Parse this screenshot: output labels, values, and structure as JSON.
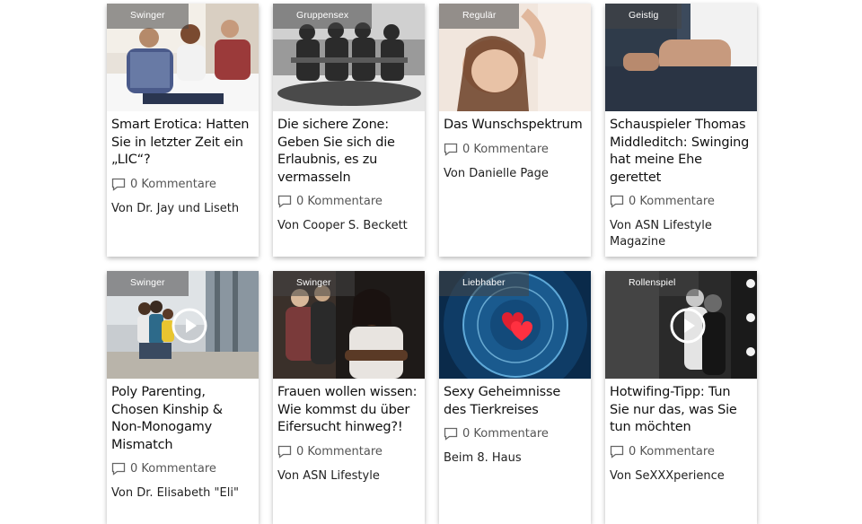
{
  "cards": [
    {
      "category": "Swinger",
      "title": "Smart Erotica: Hatten Sie in letzter Zeit ein „LIC“?",
      "comments": "0 Kommentare",
      "author": "Von Dr. Jay und Liseth",
      "has_play": false
    },
    {
      "category": "Gruppensex",
      "title": "Die sichere Zone: Geben Sie sich die Erlaubnis, es zu vermasseln",
      "comments": "0 Kommentare",
      "author": "Von Cooper S. Beckett",
      "has_play": false
    },
    {
      "category": "Regulär",
      "title": "Das Wunschspektrum",
      "comments": "0 Kommentare",
      "author": "Von Danielle Page",
      "has_play": false
    },
    {
      "category": "Geistig",
      "title": "Schauspieler Thomas Middleditch: Swinging hat meine Ehe gerettet",
      "comments": "0 Kommentare",
      "author": "Von ASN Lifestyle Magazine",
      "has_play": false
    },
    {
      "category": "Swinger",
      "title": "Poly Parenting, Chosen Kinship & Non-Monogamy Mismatch",
      "comments": "0 Kommentare",
      "author": "Von Dr. Elisabeth \"Eli\"",
      "has_play": true
    },
    {
      "category": "Swinger",
      "title": "Frauen wollen wissen: Wie kommst du über Eifersucht hinweg?!",
      "comments": "0 Kommentare",
      "author": "Von ASN Lifestyle",
      "has_play": false
    },
    {
      "category": "Liebhaber",
      "title": "Sexy Geheimnisse des Tierkreises",
      "comments": "0 Kommentare",
      "author": "Beim 8. Haus",
      "has_play": false
    },
    {
      "category": "Rollenspiel",
      "title": "Hotwifing-Tipp: Tun Sie nur das, was Sie tun möchten",
      "comments": "0 Kommentare",
      "author": "Von SeXXXperience",
      "has_play": true
    }
  ]
}
